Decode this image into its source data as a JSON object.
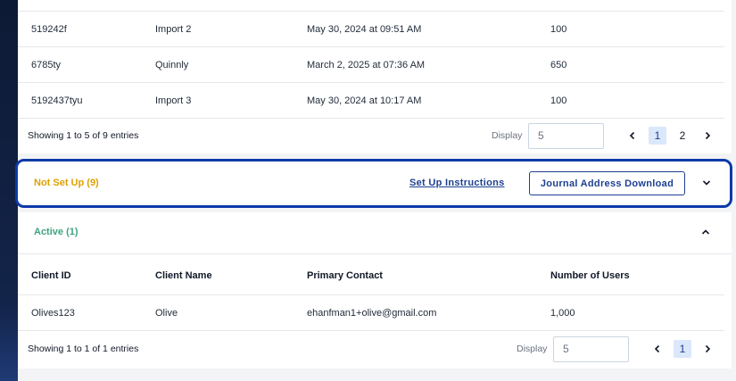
{
  "top_table": {
    "rows": [
      {
        "client_id": "519242f",
        "client_name": "Import 2",
        "date": "May 30, 2024 at 09:51 AM",
        "users": "100"
      },
      {
        "client_id": "6785ty",
        "client_name": "Quinnly",
        "date": "March 2, 2025 at 07:36 AM",
        "users": "650"
      },
      {
        "client_id": "5192437tyu",
        "client_name": "Import 3",
        "date": "May 30, 2024 at 10:17 AM",
        "users": "100"
      }
    ],
    "footer": {
      "showing": "Showing 1 to 5 of 9 entries",
      "display_label": "Display",
      "display_value": "5",
      "pages": [
        "1",
        "2"
      ],
      "current_page": "1"
    }
  },
  "not_set_up": {
    "title": "Not Set Up (9)",
    "setup_link": "Set Up Instructions",
    "journal_button": "Journal Address Download"
  },
  "active": {
    "title": "Active (1)",
    "columns": [
      "Client ID",
      "Client Name",
      "Primary Contact",
      "Number of Users"
    ],
    "rows": [
      {
        "client_id": "Olives123",
        "client_name": "Olive",
        "contact": "ehanfman1+olive@gmail.com",
        "users": "1,000"
      }
    ],
    "footer": {
      "showing": "Showing 1 to 1 of 1 entries",
      "display_label": "Display",
      "display_value": "5",
      "pages": [
        "1"
      ],
      "current_page": "1"
    }
  },
  "icons": {
    "prev": "chevron-left-icon",
    "next": "chevron-right-icon",
    "expand": "chevron-down-icon",
    "collapse": "chevron-up-icon"
  },
  "colors": {
    "accent": "#1d3f91",
    "highlight_border": "#0d3aa8",
    "warning": "#e0a100",
    "success": "#3fa37d",
    "active_page_bg": "#dbe7fb"
  }
}
